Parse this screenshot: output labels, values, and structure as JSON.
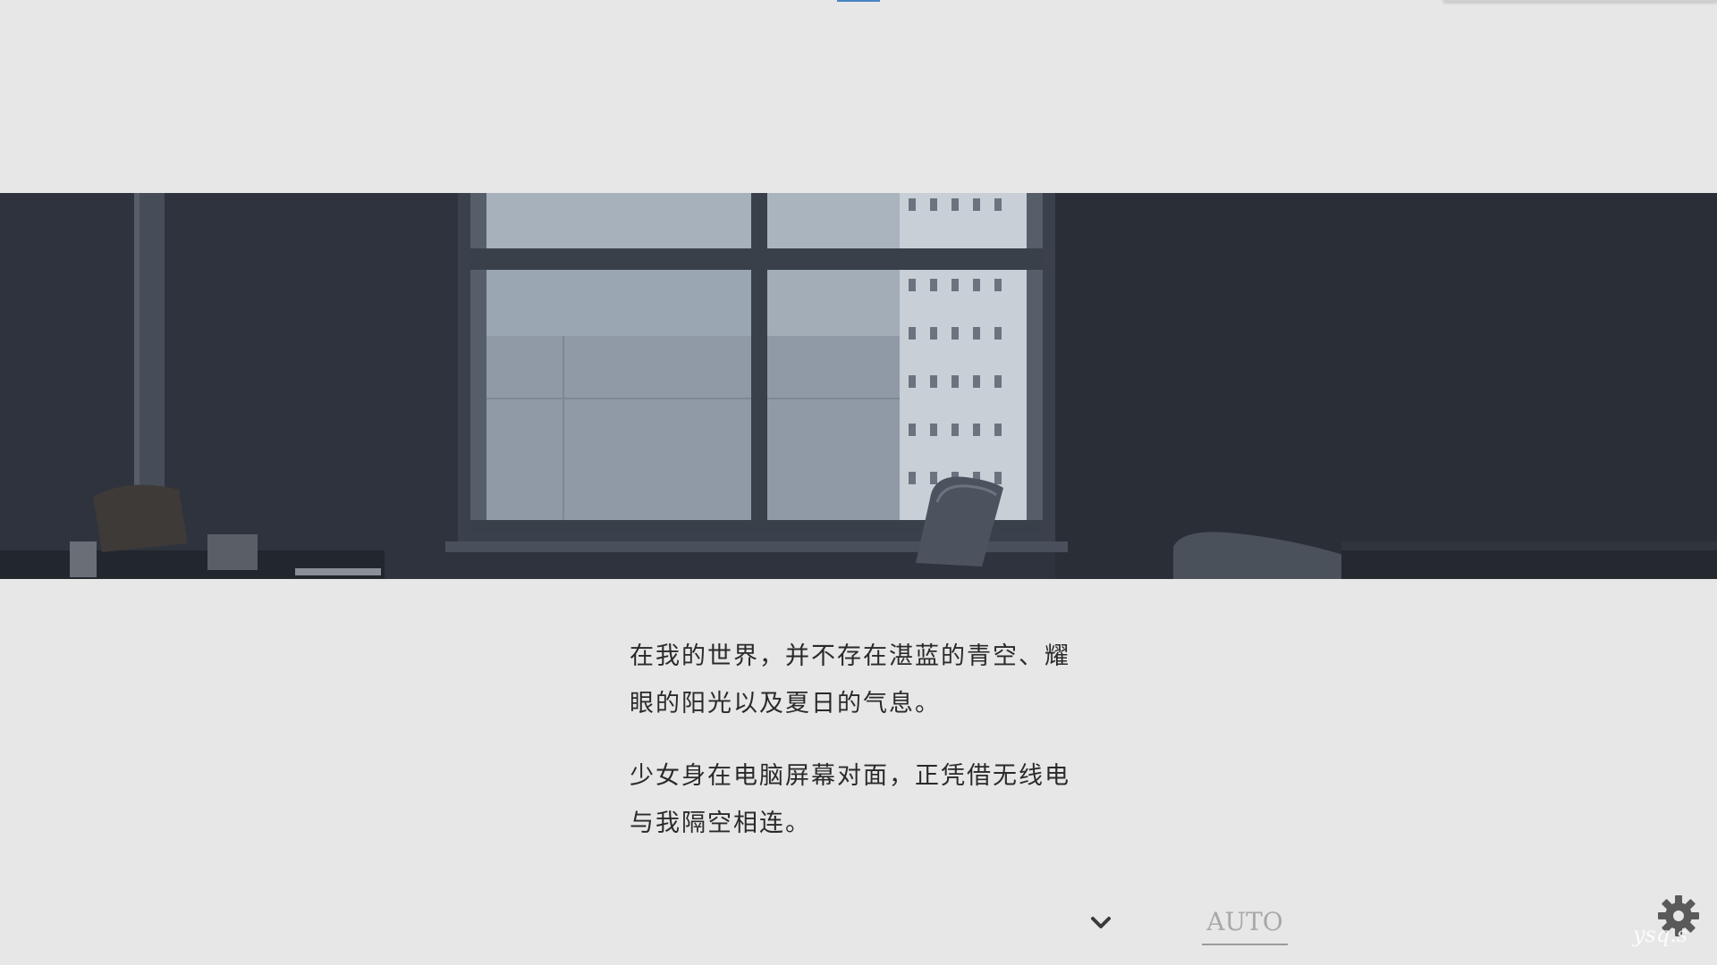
{
  "dialogue": {
    "paragraphs": [
      {
        "line1": "在我的世界，并不存在湛蓝的青空、耀",
        "line2": "眼的阳光以及夏日的气息。"
      },
      {
        "line1": "少女身在电脑屏幕对面，正凭借无线电",
        "line2": "与我隔空相连。"
      }
    ]
  },
  "controls": {
    "auto_label": "AUTO",
    "next_icon": "chevron-down-icon",
    "settings_icon": "gear-icon"
  },
  "signature_text": "ysq.s",
  "colors": {
    "background": "#e7e7e7",
    "text": "#2a2a2a",
    "accent": "#4a84c4",
    "scene_dark": "#2c313b",
    "window_light": "#aab6c2"
  }
}
